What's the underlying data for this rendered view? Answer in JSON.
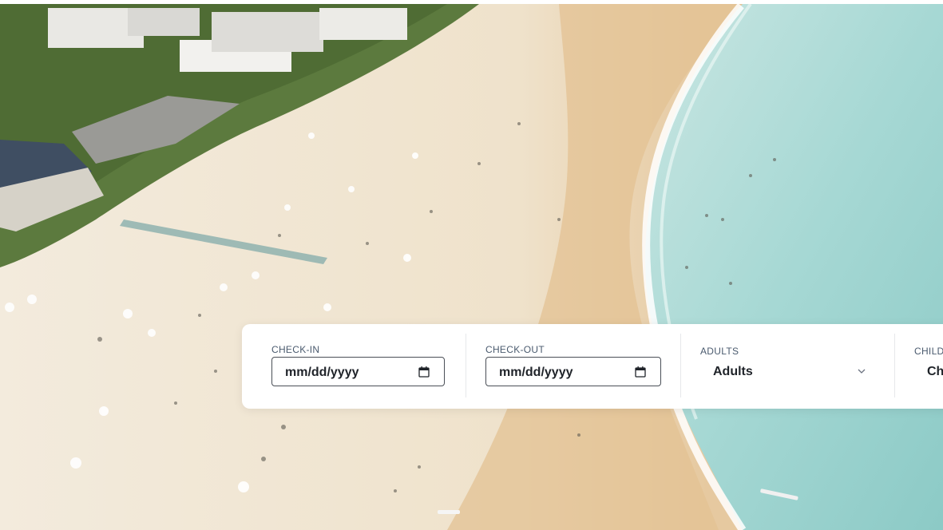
{
  "booking": {
    "check_in": {
      "label": "CHECK-IN",
      "value": "mm/dd/yyyy",
      "icon": "calendar-icon"
    },
    "check_out": {
      "label": "CHECK-OUT",
      "value": "mm/dd/yyyy",
      "icon": "calendar-icon"
    },
    "adults": {
      "label": "ADULTS",
      "value": "Adults",
      "icon": "chevron-down-icon"
    },
    "children": {
      "label": "CHILDREN",
      "value": "Children",
      "icon": "chevron-down-icon"
    }
  },
  "colors": {
    "sand": "#efe3cf",
    "water": "#a9d6d2",
    "field_border": "#4a4f57",
    "label": "#4a5a6e",
    "text": "#1f2329"
  }
}
